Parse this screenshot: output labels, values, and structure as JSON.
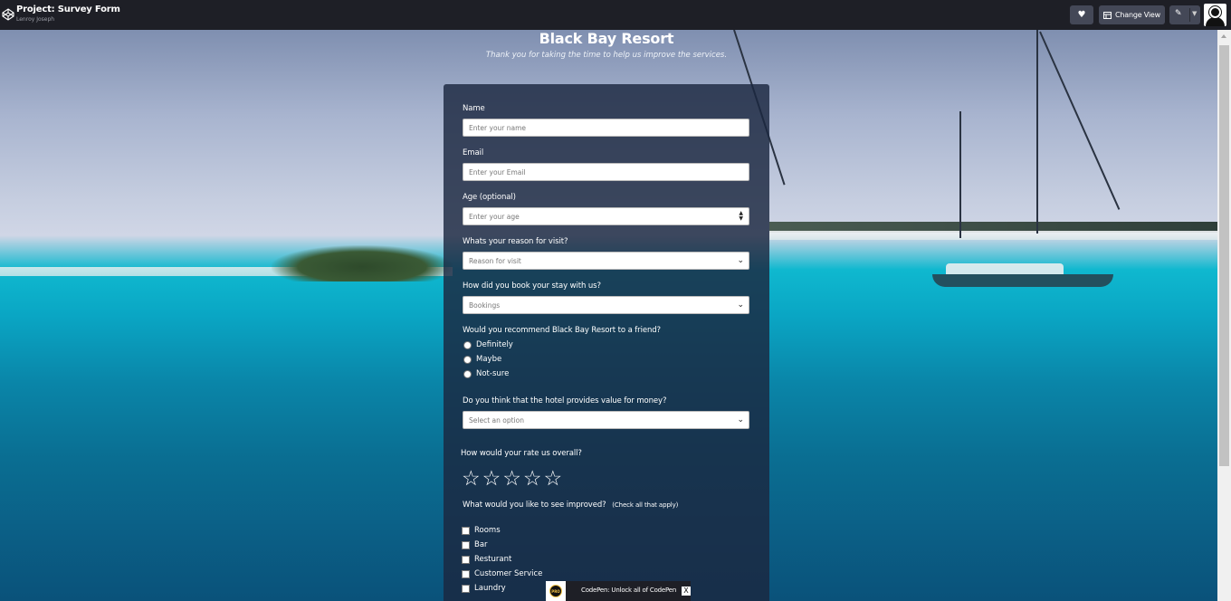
{
  "topbar": {
    "project_title": "Project: Survey Form",
    "author": "Lenroy Joseph",
    "change_view_label": "Change View",
    "logo_icon": "codepen-logo-icon",
    "heart_icon": "heart-icon",
    "pin_icon": "pin-icon",
    "chevron_icon": "chevron-down-icon"
  },
  "header": {
    "title": "Black Bay Resort",
    "description": "Thank you for taking the time to help us improve the services."
  },
  "form": {
    "name_label": "Name",
    "name_placeholder": "Enter your name",
    "email_label": "Email",
    "email_placeholder": "Enter your Email",
    "age_label": "Age (optional)",
    "age_placeholder": "Enter your age",
    "reason_label": "Whats your reason for visit?",
    "reason_selected": "Reason for visit",
    "booking_label": "How did you book your stay with us?",
    "booking_selected": "Bookings",
    "recommend_label": "Would you recommend Black Bay Resort to a friend?",
    "recommend_options": [
      "Definitely",
      "Maybe",
      "Not-sure"
    ],
    "value_label": "Do you think that the hotel provides value for money?",
    "value_selected": "Select an option",
    "rating_label": "How would your rate us overall?",
    "rating_stars": 5,
    "rating_value": 0,
    "improve_label": "What would you like to see improved?",
    "improve_note": "(Check all that apply)",
    "improve_options": [
      "Rooms",
      "Bar",
      "Resturant",
      "Customer Service",
      "Laundry"
    ]
  },
  "promo": {
    "badge": "PRO",
    "text": "CodePen: Unlock all of CodePen",
    "close_label": "X"
  }
}
